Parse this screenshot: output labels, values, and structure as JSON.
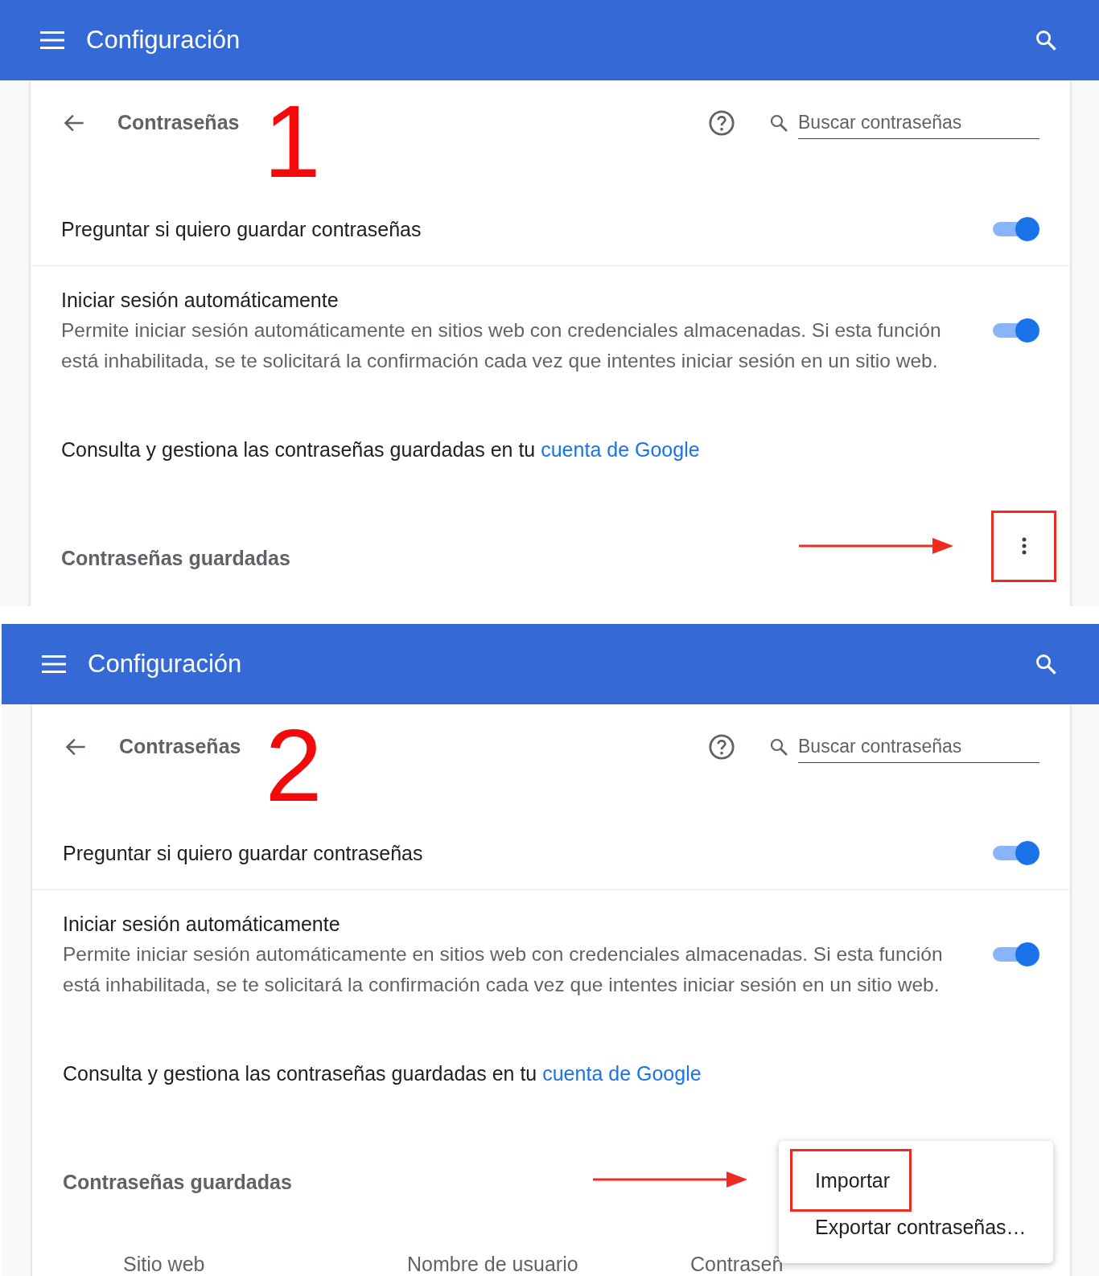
{
  "panels": [
    {
      "app_bar": {
        "title": "Configuración"
      },
      "page_title": "Contraseñas",
      "step_label": "1",
      "search": {
        "placeholder": "Buscar contraseñas"
      },
      "settings": [
        {
          "title": "Preguntar si quiero guardar contraseñas",
          "on": true
        },
        {
          "title": "Iniciar sesión automáticamente",
          "description": "Permite iniciar sesión automáticamente en sitios web con credenciales almacenadas. Si esta función está inhabilitada, se te solicitará la confirmación cada vez que intentes iniciar sesión en un sitio web.",
          "on": true
        }
      ],
      "account_note": {
        "text": "Consulta y gestiona las contraseñas guardadas en tu",
        "link": "cuenta de Google"
      },
      "saved_title": "Contraseñas guardadas",
      "actions": {
        "kind": "menu_button",
        "highlighted": true
      }
    },
    {
      "app_bar": {
        "title": "Configuración"
      },
      "page_title": "Contraseñas",
      "step_label": "2",
      "search": {
        "placeholder": "Buscar contraseñas"
      },
      "settings": [
        {
          "title": "Preguntar si quiero guardar contraseñas",
          "on": true
        },
        {
          "title": "Iniciar sesión automáticamente",
          "description": "Permite iniciar sesión automáticamente en sitios web con credenciales almacenadas. Si esta función está inhabilitada, se te solicitará la confirmación cada vez que intentes iniciar sesión en un sitio web.",
          "on": true
        }
      ],
      "account_note": {
        "text": "Consulta y gestiona las contraseñas guardadas en tu",
        "link": "cuenta de Google"
      },
      "saved_title": "Contraseñas guardadas",
      "actions": {
        "kind": "menu",
        "items": [
          {
            "label": "Importar",
            "highlighted": true
          },
          {
            "label": "Exportar contraseñas…",
            "highlighted": false
          }
        ]
      },
      "columns": [
        "Sitio web",
        "Nombre de usuario",
        "Contraseñ"
      ]
    }
  ]
}
